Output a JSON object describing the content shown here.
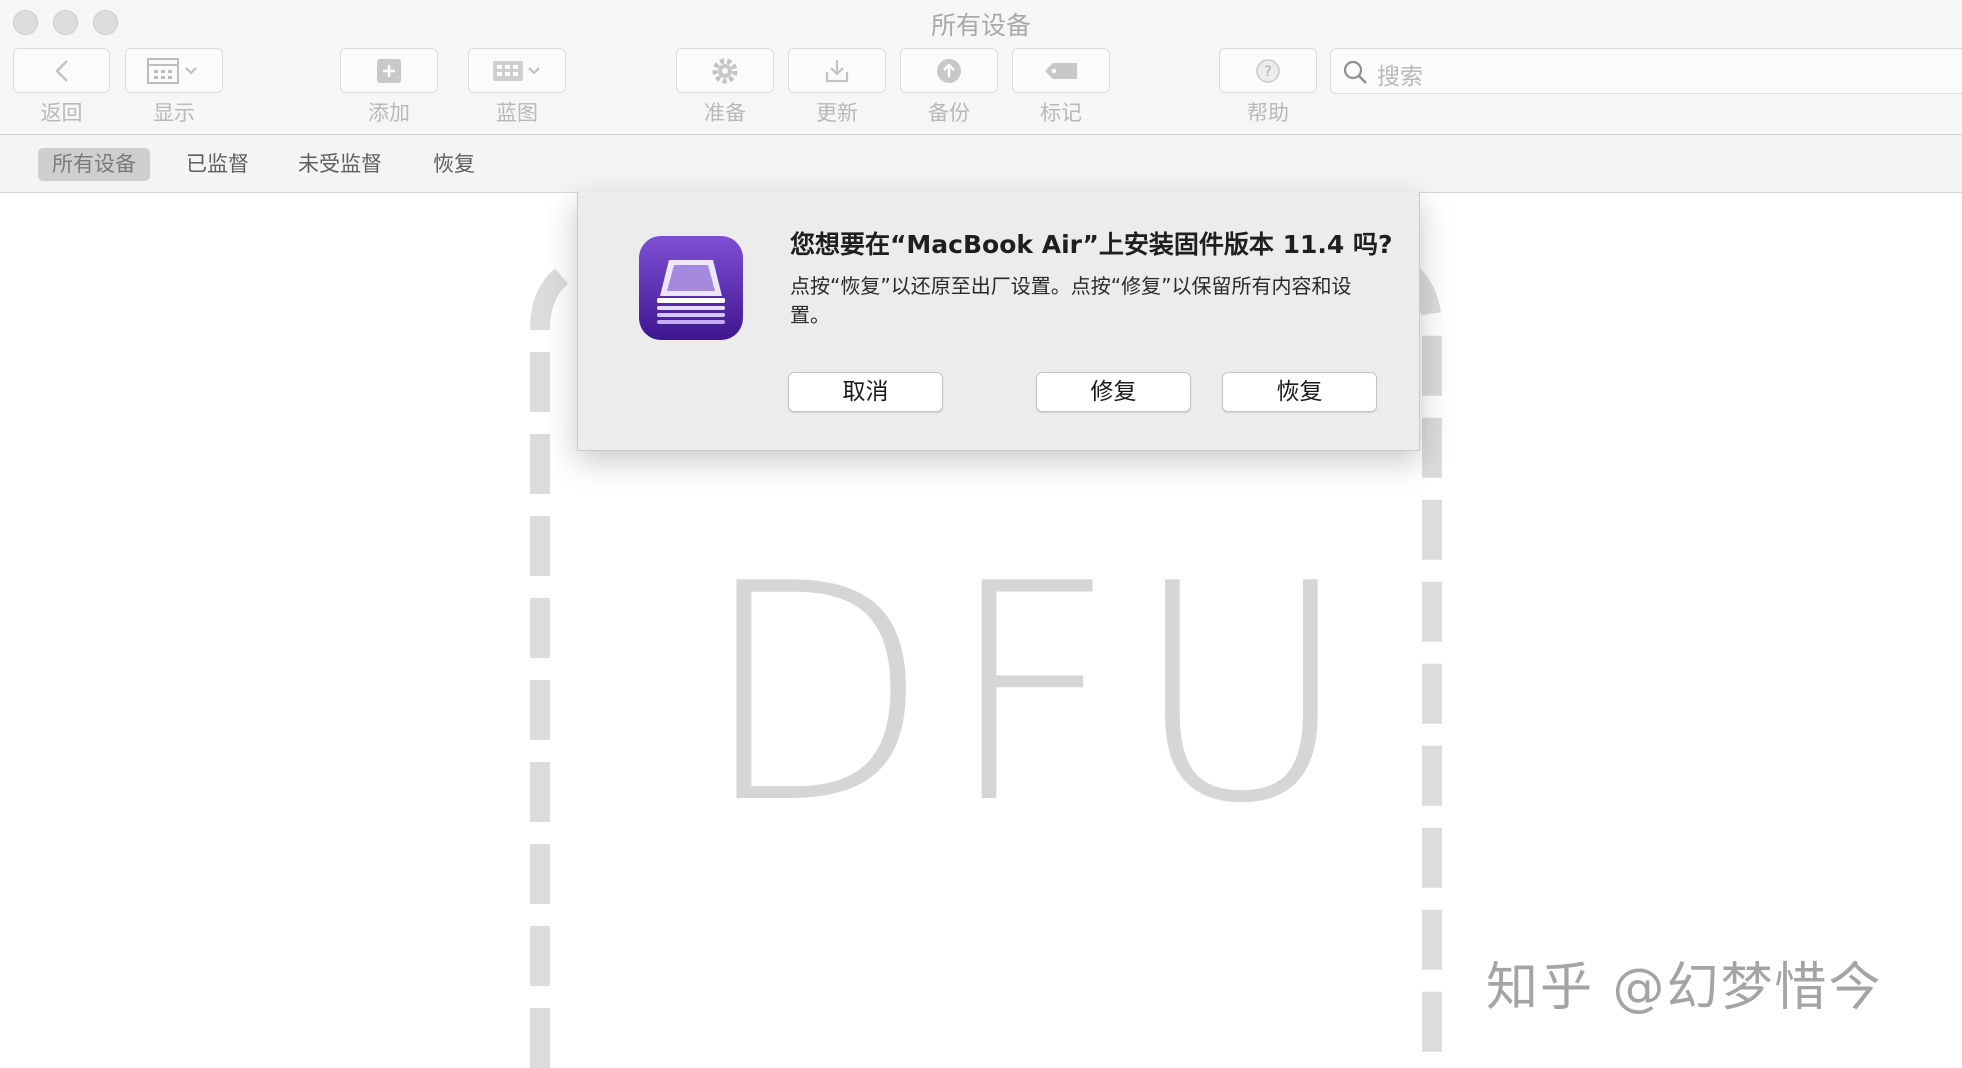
{
  "window": {
    "title": "所有设备"
  },
  "toolbar": {
    "back_label": "返回",
    "display_label": "显示",
    "add_label": "添加",
    "blueprint_label": "蓝图",
    "prepare_label": "准备",
    "update_label": "更新",
    "backup_label": "备份",
    "tag_label": "标记",
    "help_label": "帮助"
  },
  "search": {
    "placeholder": "搜索"
  },
  "filters": {
    "all": "所有设备",
    "supervised": "已监督",
    "unsupervised": "未受监督",
    "recovery": "恢复"
  },
  "device": {
    "label": "DFU"
  },
  "dialog": {
    "title": "您想要在“MacBook Air”上安装固件版本 11.4 吗?",
    "message": "点按“恢复”以还原至出厂设置。点按“修复”以保留所有内容和设置。",
    "cancel_label": "取消",
    "revive_label": "修复",
    "restore_label": "恢复"
  },
  "watermark": {
    "text": "知乎 @幻梦惜今"
  }
}
